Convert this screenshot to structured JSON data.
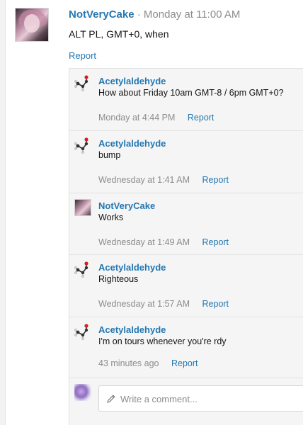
{
  "post": {
    "author": "NotVeryCake",
    "separator": "·",
    "time": "Monday at 11:00 AM",
    "body": "ALT PL, GMT+0, when",
    "report_label": "Report"
  },
  "comments": [
    {
      "author": "Acetylaldehyde",
      "text": "How about Friday 10am GMT-8 / 6pm GMT+0?",
      "time": "Monday at 4:44 PM",
      "report": "Report",
      "avatar": "molecule-icon"
    },
    {
      "author": "Acetylaldehyde",
      "text": "bump",
      "time": "Wednesday at 1:41 AM",
      "report": "Report",
      "avatar": "molecule-icon"
    },
    {
      "author": "NotVeryCake",
      "text": "Works",
      "time": "Wednesday at 1:49 AM",
      "report": "Report",
      "avatar": "anime-girl-avatar"
    },
    {
      "author": "Acetylaldehyde",
      "text": "Righteous",
      "time": "Wednesday at 1:57 AM",
      "report": "Report",
      "avatar": "molecule-icon"
    },
    {
      "author": "Acetylaldehyde",
      "text": "I'm on tours whenever you're rdy",
      "time": "43 minutes ago",
      "report": "Report",
      "avatar": "molecule-icon"
    }
  ],
  "composer": {
    "placeholder": "Write a comment...",
    "icon": "pencil-icon"
  },
  "colors": {
    "link": "#2577b1",
    "meta": "#8c8c8c",
    "comment_bg": "#f5f5f5"
  }
}
